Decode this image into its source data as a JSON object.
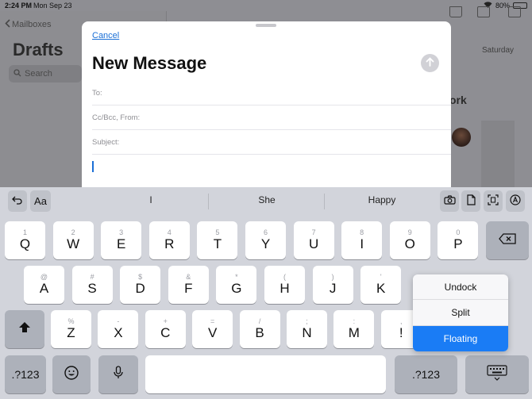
{
  "status_bar": {
    "time": "2:24 PM",
    "date": "Mon Sep 23",
    "battery": "80%",
    "battery_level": 0.8
  },
  "mail_background": {
    "back_label": "Mailboxes",
    "title": "Drafts",
    "search_placeholder": "Search",
    "date_label": "Saturday",
    "snippet_text": "ork"
  },
  "compose": {
    "cancel_label": "Cancel",
    "title": "New Message",
    "to_label": "To:",
    "ccbcc_label": "Cc/Bcc, From:",
    "subject_label": "Subject:"
  },
  "keyboard": {
    "suggestions": [
      "I",
      "She",
      "Happy"
    ],
    "format_label": "Aa",
    "row1": [
      {
        "main": "Q",
        "alt": "1"
      },
      {
        "main": "W",
        "alt": "2"
      },
      {
        "main": "E",
        "alt": "3"
      },
      {
        "main": "R",
        "alt": "4"
      },
      {
        "main": "T",
        "alt": "5"
      },
      {
        "main": "Y",
        "alt": "6"
      },
      {
        "main": "U",
        "alt": "7"
      },
      {
        "main": "I",
        "alt": "8"
      },
      {
        "main": "O",
        "alt": "9"
      },
      {
        "main": "P",
        "alt": "0"
      }
    ],
    "row2": [
      {
        "main": "A",
        "alt": "@"
      },
      {
        "main": "S",
        "alt": "#"
      },
      {
        "main": "D",
        "alt": "$"
      },
      {
        "main": "F",
        "alt": "&"
      },
      {
        "main": "G",
        "alt": "*"
      },
      {
        "main": "H",
        "alt": "("
      },
      {
        "main": "J",
        "alt": ")"
      },
      {
        "main": "K",
        "alt": "'"
      }
    ],
    "row3": [
      {
        "main": "Z",
        "alt": "%"
      },
      {
        "main": "X",
        "alt": "-"
      },
      {
        "main": "C",
        "alt": "+"
      },
      {
        "main": "V",
        "alt": "="
      },
      {
        "main": "B",
        "alt": "/"
      },
      {
        "main": "N",
        "alt": ";"
      },
      {
        "main": "M",
        "alt": ":"
      },
      {
        "main": "!",
        "alt": ","
      }
    ],
    "numbers_label": ".?123",
    "numbers_label_right": ".?123"
  },
  "keyboard_menu": {
    "items": [
      "Undock",
      "Split",
      "Floating"
    ],
    "selected": "Floating"
  },
  "colors": {
    "accent": "#1a7cf5",
    "link": "#1a6fd6"
  }
}
